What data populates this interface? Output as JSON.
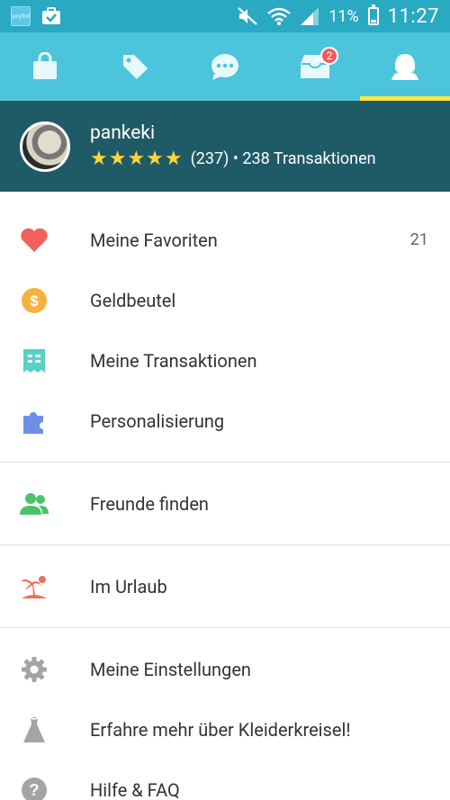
{
  "status_bar": {
    "app_icon_text": "jucyfnd",
    "battery_percent": "11%",
    "time": "11:27"
  },
  "tabs": [
    {
      "icon": "shopping-bag-icon",
      "active": false
    },
    {
      "icon": "tag-icon",
      "active": false
    },
    {
      "icon": "chat-icon",
      "active": false
    },
    {
      "icon": "inbox-icon",
      "active": false,
      "badge": "2"
    },
    {
      "icon": "profile-icon",
      "active": true
    }
  ],
  "profile": {
    "username": "pankeki",
    "stars": "★★★★★",
    "rating_summary": "(237) • 238 Transaktionen"
  },
  "menu": {
    "favorites": {
      "label": "Meine Favoriten",
      "count": "21"
    },
    "wallet": {
      "label": "Geldbeutel"
    },
    "transactions": {
      "label": "Meine Transaktionen"
    },
    "personalization": {
      "label": "Personalisierung"
    },
    "find_friends": {
      "label": "Freunde finden"
    },
    "vacation": {
      "label": "Im Urlaub"
    },
    "settings": {
      "label": "Meine Einstellungen"
    },
    "learn_more": {
      "label": "Erfahre mehr über Kleiderkreisel!"
    },
    "help": {
      "label": "Hilfe & FAQ"
    }
  },
  "colors": {
    "status_bar": "#2aa9c2",
    "tab_bar": "#4cc4db",
    "tab_indicator": "#ffe93a",
    "profile_bg": "#1f5a67",
    "star": "#ffd43b"
  }
}
